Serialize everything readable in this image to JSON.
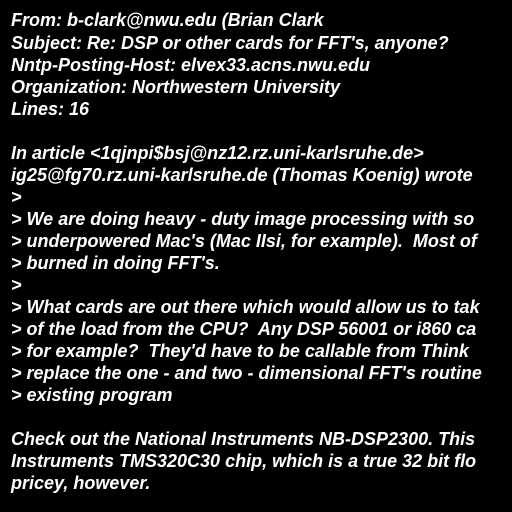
{
  "header": {
    "from": "From: b-clark@nwu.edu (Brian Clark",
    "subject": "Subject: Re: DSP or other cards for FFT's, anyone?",
    "nntp_posting_host": "Nntp-Posting-Host: elvex33.acns.nwu.edu",
    "organization": "Organization: Northwestern University",
    "lines": "Lines: 16"
  },
  "body": {
    "attribution_1": "In article <1qjnpi$bsj@nz12.rz.uni-karlsruhe.de>",
    "attribution_2": "ig25@fg70.rz.uni-karlsruhe.de (Thomas Koenig) wrote",
    "quoted": [
      ">",
      "> We are doing heavy - duty image processing with so",
      "> underpowered Mac's (Mac IIsi, for example).  Most of",
      "> burned in doing FFT's.",
      ">",
      "> What cards are out there which would allow us to tak",
      "> of the load from the CPU?  Any DSP 56001 or i860 ca",
      "> for example?  They'd have to be callable from Think",
      "> replace the one - and two - dimensional FFT's routine",
      "> existing program"
    ],
    "reply": [
      "Check out the National Instruments NB-DSP2300. This",
      "Instruments TMS320C30 chip, which is a true 32 bit flo",
      "pricey, however."
    ]
  }
}
